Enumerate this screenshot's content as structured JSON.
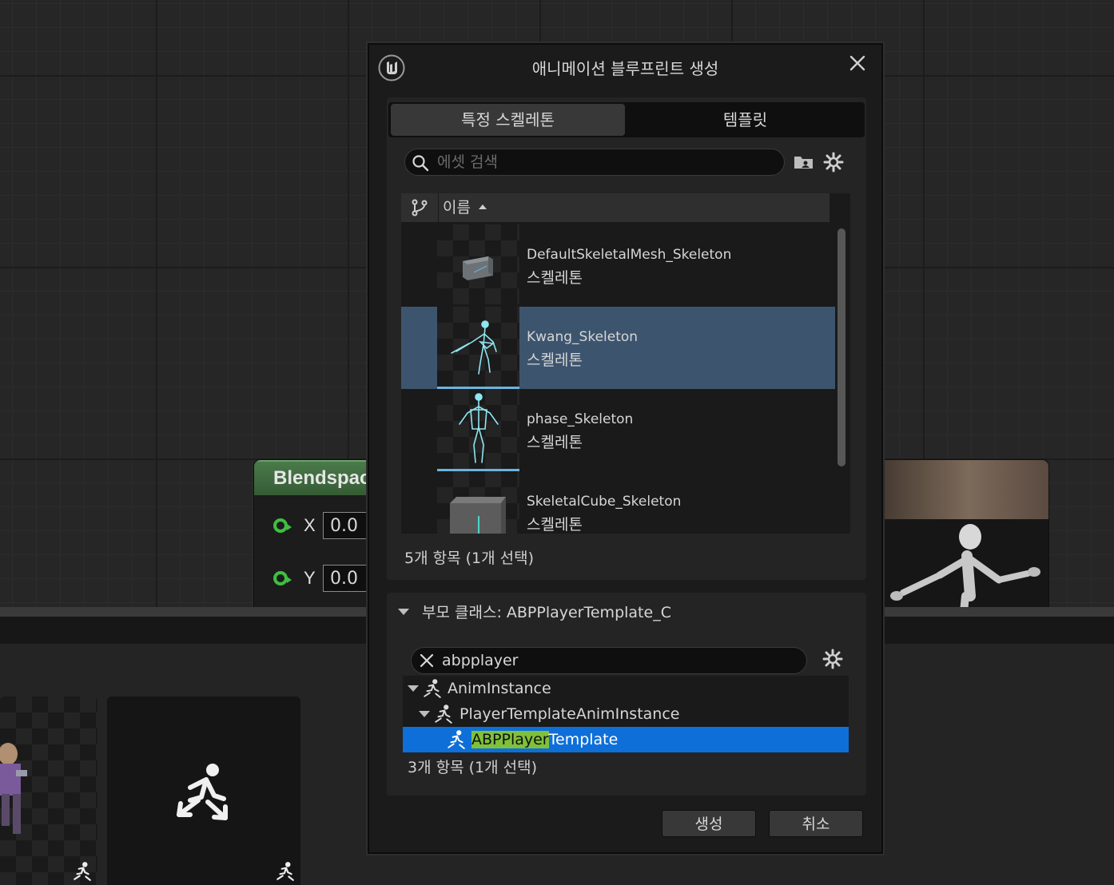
{
  "dialog": {
    "title": "애니메이션 블루프린트 생성",
    "tabs": [
      {
        "label": "특정 스켈레톤",
        "active": true
      },
      {
        "label": "템플릿",
        "active": false
      }
    ],
    "asset_search": {
      "placeholder": "에셋 검색",
      "value": ""
    },
    "list": {
      "column_header": "이름",
      "rows": [
        {
          "name": "DefaultSkeletalMesh_Skeleton",
          "type": "스켈레톤",
          "selected": false
        },
        {
          "name": "Kwang_Skeleton",
          "type": "스켈레톤",
          "selected": true
        },
        {
          "name": "phase_Skeleton",
          "type": "스켈레톤",
          "selected": false
        },
        {
          "name": "SkeletalCube_Skeleton",
          "type": "스켈레톤",
          "selected": false
        }
      ],
      "status": "5개 항목 (1개 선택)"
    },
    "parent_class": {
      "header": "부모 클래스: ABPPlayerTemplate_C",
      "search_value": "abpplayer",
      "tree": [
        {
          "label": "AnimInstance",
          "depth": 0,
          "expanded": true,
          "selected": false
        },
        {
          "label": "PlayerTemplateAnimInstance",
          "depth": 1,
          "expanded": true,
          "selected": false
        },
        {
          "label_highlight": "ABPPlayer",
          "label_rest": "Template",
          "depth": 2,
          "selected": true
        }
      ],
      "status": "3개 항목 (1개 선택)"
    },
    "buttons": {
      "create": "생성",
      "cancel": "취소"
    }
  },
  "graph": {
    "node_title": "Blendspac",
    "pins": [
      {
        "label": "X",
        "value": "0.0"
      },
      {
        "label": "Y",
        "value": "0.0"
      }
    ]
  },
  "colors": {
    "selection_row": "#3d546e",
    "tree_selection": "#0e6fd8",
    "search_highlight": "#7fc13b",
    "node_header": "#4a7a4a",
    "pin_green": "#3fbf3f"
  }
}
